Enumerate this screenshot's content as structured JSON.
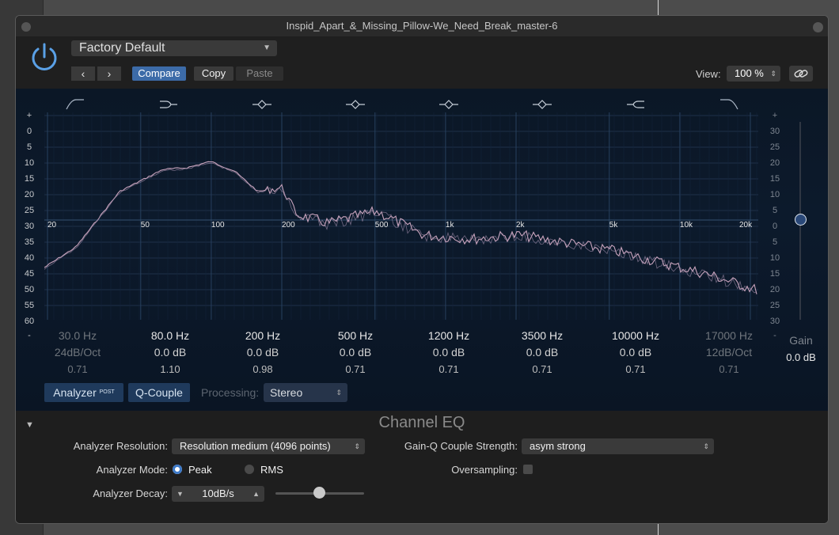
{
  "window": {
    "title": "Inspid_Apart_&_Missing_Pillow-We_Need_Break_master-6"
  },
  "header": {
    "preset": "Factory Default",
    "prev": "‹",
    "next": "›",
    "compare": "Compare",
    "copy": "Copy",
    "paste": "Paste",
    "view_label": "View:",
    "view_value": "100 %"
  },
  "graph": {
    "left_scale": [
      "+",
      "0",
      "5",
      "10",
      "15",
      "20",
      "25",
      "30",
      "35",
      "40",
      "45",
      "50",
      "55",
      "60",
      "-"
    ],
    "right_scale": [
      "+",
      "30",
      "25",
      "20",
      "15",
      "10",
      "5",
      "0",
      "5",
      "10",
      "15",
      "20",
      "25",
      "30",
      "-"
    ],
    "freq_labels": [
      "20",
      "50",
      "100",
      "200",
      "500",
      "1k",
      "2k",
      "5k",
      "10k",
      "20k"
    ],
    "gain_label": "Gain",
    "gain_value": "0.0 dB"
  },
  "bands": [
    {
      "freq": "30.0 Hz",
      "gain": "24dB/Oct",
      "q": "0.71",
      "icon": "low-cut-icon",
      "enabled": false
    },
    {
      "freq": "80.0 Hz",
      "gain": "0.0 dB",
      "q": "1.10",
      "icon": "low-shelf-icon",
      "enabled": true
    },
    {
      "freq": "200 Hz",
      "gain": "0.0 dB",
      "q": "0.98",
      "icon": "bell-icon",
      "enabled": true
    },
    {
      "freq": "500 Hz",
      "gain": "0.0 dB",
      "q": "0.71",
      "icon": "bell-icon",
      "enabled": true
    },
    {
      "freq": "1200 Hz",
      "gain": "0.0 dB",
      "q": "0.71",
      "icon": "bell-icon",
      "enabled": true
    },
    {
      "freq": "3500 Hz",
      "gain": "0.0 dB",
      "q": "0.71",
      "icon": "bell-icon",
      "enabled": true
    },
    {
      "freq": "10000 Hz",
      "gain": "0.0 dB",
      "q": "0.71",
      "icon": "high-shelf-icon",
      "enabled": true
    },
    {
      "freq": "17000 Hz",
      "gain": "12dB/Oct",
      "q": "0.71",
      "icon": "high-cut-icon",
      "enabled": false
    }
  ],
  "controls": {
    "analyzer": "Analyzer",
    "analyzer_badge": "POST",
    "q_couple": "Q-Couple",
    "processing_label": "Processing:",
    "processing_value": "Stereo"
  },
  "bottom": {
    "title": "Channel EQ",
    "analyzer_resolution_label": "Analyzer Resolution:",
    "analyzer_resolution_value": "Resolution medium (4096 points)",
    "gainq_label": "Gain-Q Couple Strength:",
    "gainq_value": "asym strong",
    "analyzer_mode_label": "Analyzer Mode:",
    "mode_peak": "Peak",
    "mode_rms": "RMS",
    "mode_selected": "Peak",
    "oversampling_label": "Oversampling:",
    "oversampling_checked": false,
    "analyzer_decay_label": "Analyzer Decay:",
    "analyzer_decay_value": "10dB/s",
    "decay_slider_level": 0.5
  },
  "colors": {
    "accent": "#3c6ba8",
    "curve": "#c9a4bd",
    "panel": "#0c1a2c"
  }
}
